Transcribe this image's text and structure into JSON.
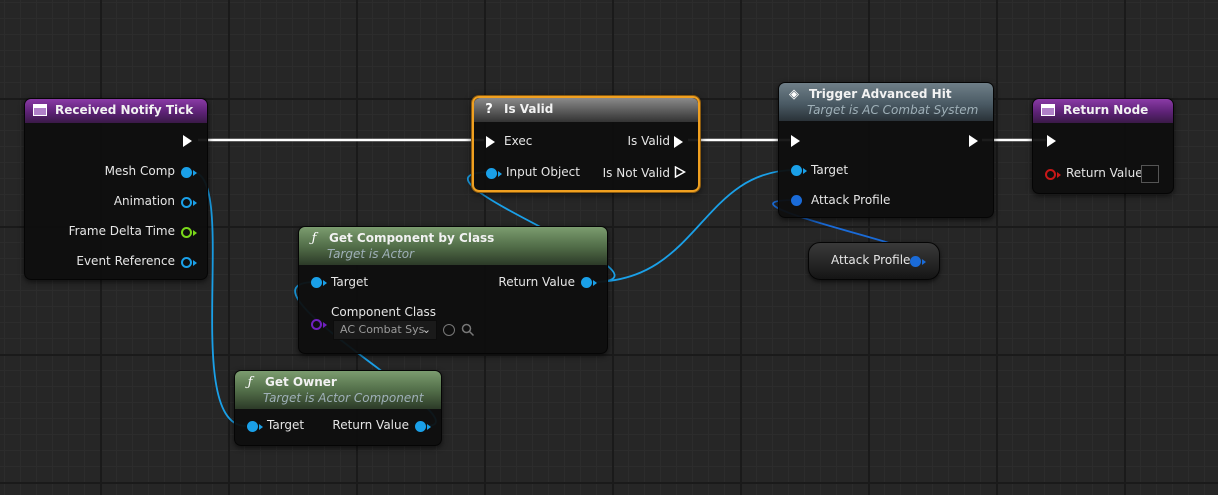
{
  "nodes": {
    "received_notify_tick": {
      "title": "Received Notify Tick",
      "pins": [
        "Mesh Comp",
        "Animation",
        "Frame Delta Time",
        "Event Reference"
      ]
    },
    "is_valid": {
      "title": "Is Valid",
      "exec_in": "Exec",
      "input_object": "Input Object",
      "out_valid": "Is Valid",
      "out_not_valid": "Is Not Valid"
    },
    "trigger_advanced_hit": {
      "title": "Trigger Advanced Hit",
      "subtitle": "Target is AC Combat System",
      "target": "Target",
      "attack_profile": "Attack Profile"
    },
    "return_node": {
      "title": "Return Node",
      "return_value": "Return Value"
    },
    "get_component_by_class": {
      "title": "Get Component by Class",
      "subtitle": "Target is Actor",
      "target": "Target",
      "component_class": "Component Class",
      "component_class_value": "AC Combat Sys",
      "return_value": "Return Value"
    },
    "get_owner": {
      "title": "Get Owner",
      "subtitle": "Target is Actor Component",
      "target": "Target",
      "return_value": "Return Value"
    },
    "attack_profile_var": {
      "label": "Attack Profile"
    }
  },
  "colors": {
    "exec_wire": "#ffffff",
    "object_pin": "#1aa0e8",
    "struct_pin": "#1a6bd8",
    "float_pin": "#7ad81a",
    "class_pin": "#7020c0",
    "bool_pin": "#c81818",
    "selection": "#f0a020"
  },
  "icons": {
    "event": "event-node-icon",
    "function": "function-icon",
    "macro": "question-mark-icon",
    "trigger": "diamond-function-icon"
  }
}
